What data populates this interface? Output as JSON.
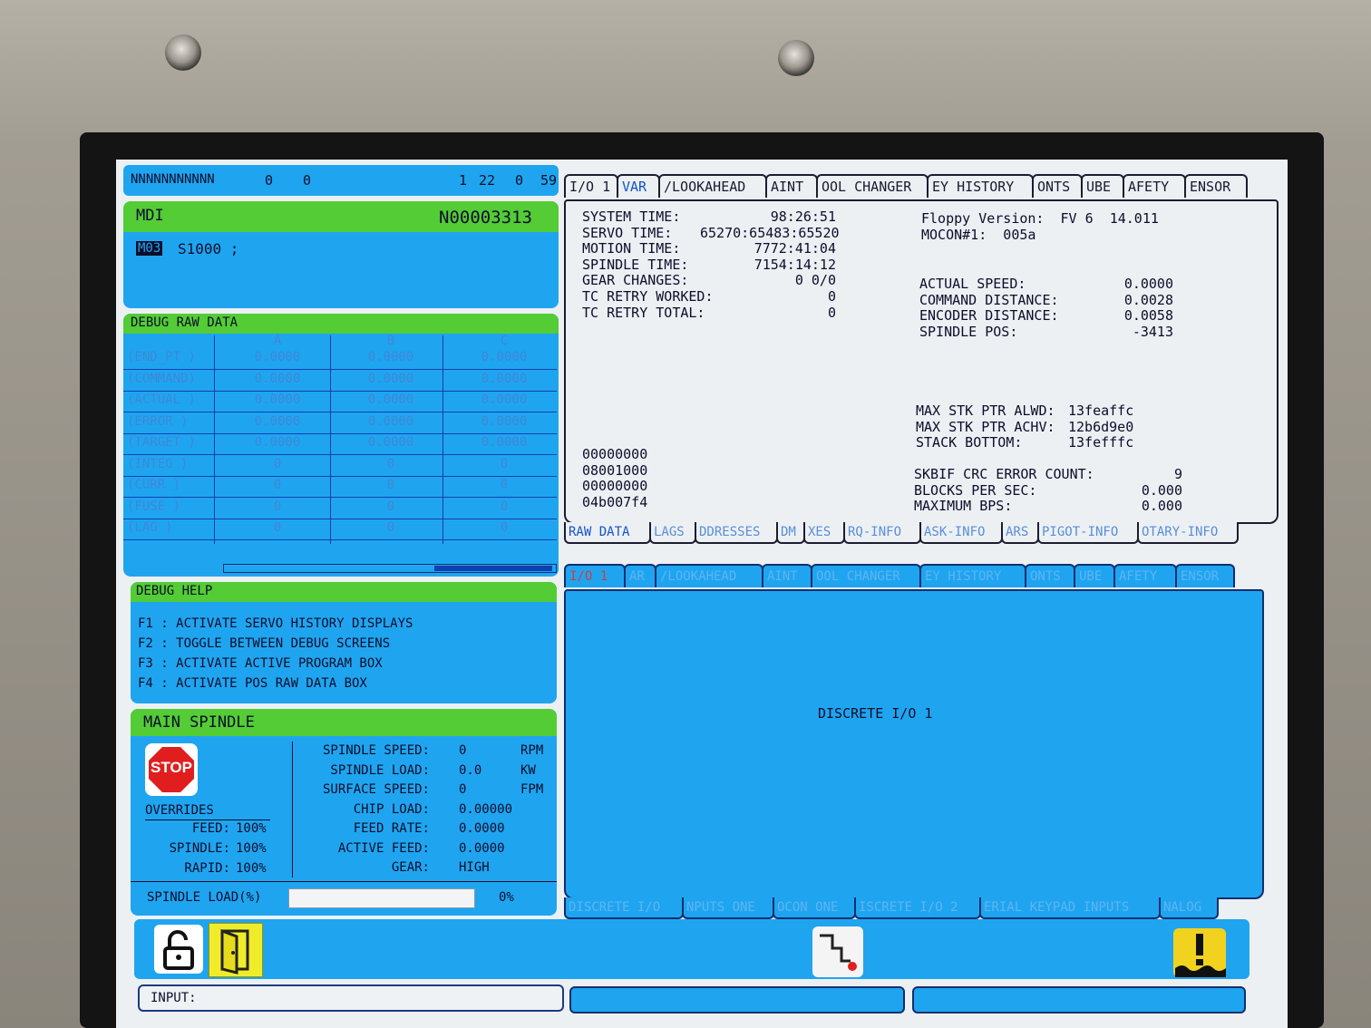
{
  "status_bar": {
    "name": "NNNNNNNNNNN",
    "v1": "0",
    "v2": "0",
    "v3": "1",
    "v4": "22",
    "v5": "0",
    "v6": "59"
  },
  "mdi": {
    "title": "MDI",
    "block": "N00003313",
    "program_code": "M03",
    "program_text": "S1000 ;"
  },
  "debug_raw": {
    "title": "DEBUG RAW DATA",
    "columns": [
      "A",
      "B",
      "C"
    ],
    "rows": [
      {
        "label": "(END_PT  )",
        "a": "0.0000",
        "b": "0.0000",
        "c": "0.0000"
      },
      {
        "label": "(COMMAND)",
        "a": "0.0000",
        "b": "0.0000",
        "c": "0.0000"
      },
      {
        "label": "(ACTUAL  )",
        "a": "0.0000",
        "b": "0.0000",
        "c": "0.0000"
      },
      {
        "label": "(ERROR   )",
        "a": "0.0000",
        "b": "0.0000",
        "c": "0.0000"
      },
      {
        "label": "(TARGET  )",
        "a": "0.0000",
        "b": "0.0000",
        "c": "0.0000"
      },
      {
        "label": "(INTEG   )",
        "a": "0",
        "b": "0",
        "c": "0"
      },
      {
        "label": "(CURR    )",
        "a": "0",
        "b": "0",
        "c": "0"
      },
      {
        "label": "(FUSE    )",
        "a": "0",
        "b": "0",
        "c": "0"
      },
      {
        "label": "(LAG     )",
        "a": "0",
        "b": "0",
        "c": "0"
      }
    ]
  },
  "debug_help": {
    "title": "DEBUG HELP",
    "lines": [
      "F1 : ACTIVATE SERVO HISTORY DISPLAYS",
      "F2 : TOGGLE BETWEEN DEBUG SCREENS",
      "F3 : ACTIVATE ACTIVE PROGRAM BOX",
      "F4 : ACTIVATE POS RAW DATA BOX"
    ]
  },
  "main_spindle": {
    "title": "MAIN SPINDLE",
    "stop_label": "STOP",
    "overrides_title": "OVERRIDES",
    "overrides": [
      {
        "label": "FEED:",
        "value": "100%"
      },
      {
        "label": "SPINDLE:",
        "value": "100%"
      },
      {
        "label": "RAPID:",
        "value": "100%"
      }
    ],
    "metrics": [
      {
        "label": "SPINDLE SPEED:",
        "value": "0",
        "unit": "RPM"
      },
      {
        "label": "SPINDLE LOAD:",
        "value": "0.0",
        "unit": "KW"
      },
      {
        "label": "SURFACE SPEED:",
        "value": "0",
        "unit": "FPM"
      },
      {
        "label": "CHIP LOAD:",
        "value": "0.00000",
        "unit": ""
      },
      {
        "label": "FEED RATE:",
        "value": "0.0000",
        "unit": ""
      },
      {
        "label": "ACTIVE FEED:",
        "value": "0.0000",
        "unit": ""
      },
      {
        "label": "GEAR:",
        "value": "HIGH",
        "unit": ""
      }
    ],
    "load_label": "SPINDLE LOAD(%)",
    "load_value": "0%",
    "load_fraction": 0
  },
  "top_tabs": [
    "I/O 1",
    "VAR",
    "/LOOKAHEAD",
    "AINT",
    "OOL CHANGER",
    "EY HISTORY",
    "ONTS",
    "UBE",
    "AFETY",
    "ENSOR"
  ],
  "var_panel": {
    "left_lines": [
      {
        "label": "SYSTEM TIME:",
        "value": "98:26:51"
      },
      {
        "label": "SERVO TIME:",
        "value": "65270:65483:65520"
      },
      {
        "label": "MOTION TIME:",
        "value": "7772:41:04"
      },
      {
        "label": "SPINDLE TIME:",
        "value": "7154:14:12"
      },
      {
        "label": "GEAR CHANGES:",
        "value": "0 0/0"
      },
      {
        "label": "TC RETRY WORKED:",
        "value": "0"
      },
      {
        "label": "TC RETRY TOTAL:",
        "value": "0"
      }
    ],
    "floppy": "Floppy Version:  FV 6  14.011",
    "mocon": "MOCON#1:  005a",
    "right_lines": [
      {
        "label": "ACTUAL SPEED:",
        "value": "0.0000"
      },
      {
        "label": "COMMAND DISTANCE:",
        "value": "0.0028"
      },
      {
        "label": "ENCODER DISTANCE:",
        "value": "0.0058"
      },
      {
        "label": "SPINDLE POS:",
        "value": "-3413"
      }
    ],
    "stack_lines": [
      {
        "label": "MAX STK PTR ALWD:",
        "value": "13feaffc"
      },
      {
        "label": "MAX STK PTR ACHV:",
        "value": "12b6d9e0"
      },
      {
        "label": "STACK BOTTOM:",
        "value": "13fefffc"
      }
    ],
    "hex_lines": [
      "00000000",
      "08001000",
      "00000000",
      "04b007f4"
    ],
    "crc_lines": [
      {
        "label": "SKBIF CRC ERROR COUNT:",
        "value": "9"
      },
      {
        "label": "BLOCKS PER SEC:",
        "value": "0.000"
      },
      {
        "label": "MAXIMUM BPS:",
        "value": "0.000"
      }
    ]
  },
  "bottom_tabs": [
    "RAW DATA",
    "LAGS",
    "DDRESSES",
    "DM",
    "XES",
    "RQ-INFO",
    "ASK-INFO",
    "ARS",
    "PIGOT-INFO",
    "OTARY-INFO"
  ],
  "lower_tabs": [
    "I/O 1",
    "AR",
    "/LOOKAHEAD",
    "AINT",
    "OOL CHANGER",
    "EY HISTORY",
    "ONTS",
    "UBE",
    "AFETY",
    "ENSOR"
  ],
  "discrete_label": "DISCRETE I/O 1",
  "lower_bottom_tabs": [
    "DISCRETE I/O",
    "NPUTS ONE",
    "OCON ONE",
    "ISCRETE I/O 2",
    "ERIAL KEYPAD INPUTS",
    "NALOG"
  ],
  "input_label": "INPUT:"
}
